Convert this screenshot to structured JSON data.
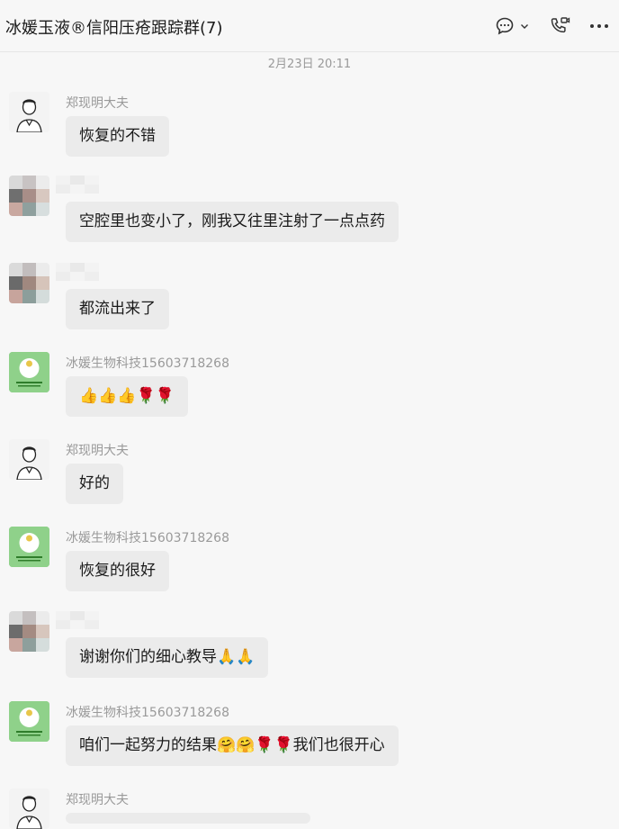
{
  "header": {
    "title": "冰媛玉液®信阳压疮跟踪群(7)",
    "icons": [
      "chat-bubble-icon",
      "chevron-down-icon",
      "video-call-icon",
      "more-icon"
    ]
  },
  "timestamp": "2月23日 20:11",
  "messages": [
    {
      "sender": "郑现明大夫",
      "avatar": "doctor",
      "text": "恢复的不错"
    },
    {
      "sender": "",
      "avatar": "blurred",
      "text": "空腔里也变小了，刚我又往里注射了一点点药"
    },
    {
      "sender": "",
      "avatar": "blurred",
      "text": "都流出来了"
    },
    {
      "sender": "冰媛生物科技15603718268",
      "avatar": "logo",
      "text": "👍👍👍🌹🌹"
    },
    {
      "sender": "郑现明大夫",
      "avatar": "doctor",
      "text": "好的"
    },
    {
      "sender": "冰媛生物科技15603718268",
      "avatar": "logo",
      "text": "恢复的很好"
    },
    {
      "sender": "",
      "avatar": "blurred",
      "text": "谢谢你们的细心教导🙏🙏"
    },
    {
      "sender": "冰媛生物科技15603718268",
      "avatar": "logo",
      "text": "咱们一起努力的结果🤗🤗🌹🌹我们也很开心"
    },
    {
      "sender": "郑现明大夫",
      "avatar": "doctor",
      "text": ""
    }
  ],
  "colors": {
    "background": "#f7f7f7",
    "bubble": "#ebebeb",
    "logo_green": "#7fc97a"
  }
}
